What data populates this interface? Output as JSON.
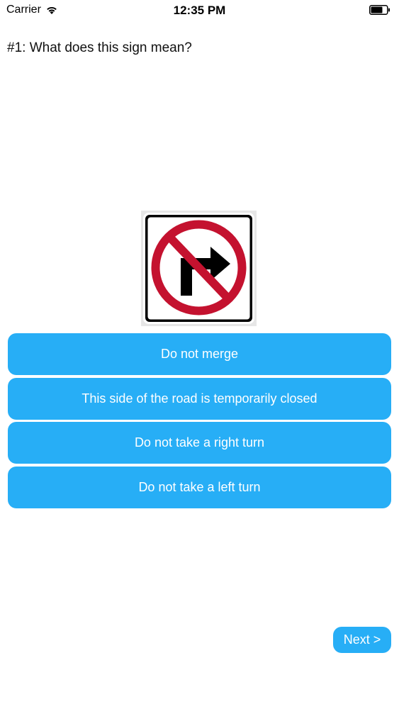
{
  "status_bar": {
    "carrier": "Carrier",
    "time": "12:35 PM",
    "wifi_icon": "wifi-icon",
    "battery_icon": "battery-icon"
  },
  "question": {
    "text": "#1: What does this sign mean?"
  },
  "sign": {
    "icon": "no-right-turn-sign",
    "colors": {
      "prohibition_red": "#c4122f",
      "arrow": "#000000",
      "border": "#000000",
      "background": "#ffffff"
    }
  },
  "answers": [
    {
      "label": "Do not merge"
    },
    {
      "label": "This side of the road is temporarily closed"
    },
    {
      "label": "Do not take a right turn"
    },
    {
      "label": "Do not take a left turn"
    }
  ],
  "next_button": {
    "label": "Next >"
  },
  "colors": {
    "accent": "#27aef6",
    "button_text": "#ffffff"
  }
}
